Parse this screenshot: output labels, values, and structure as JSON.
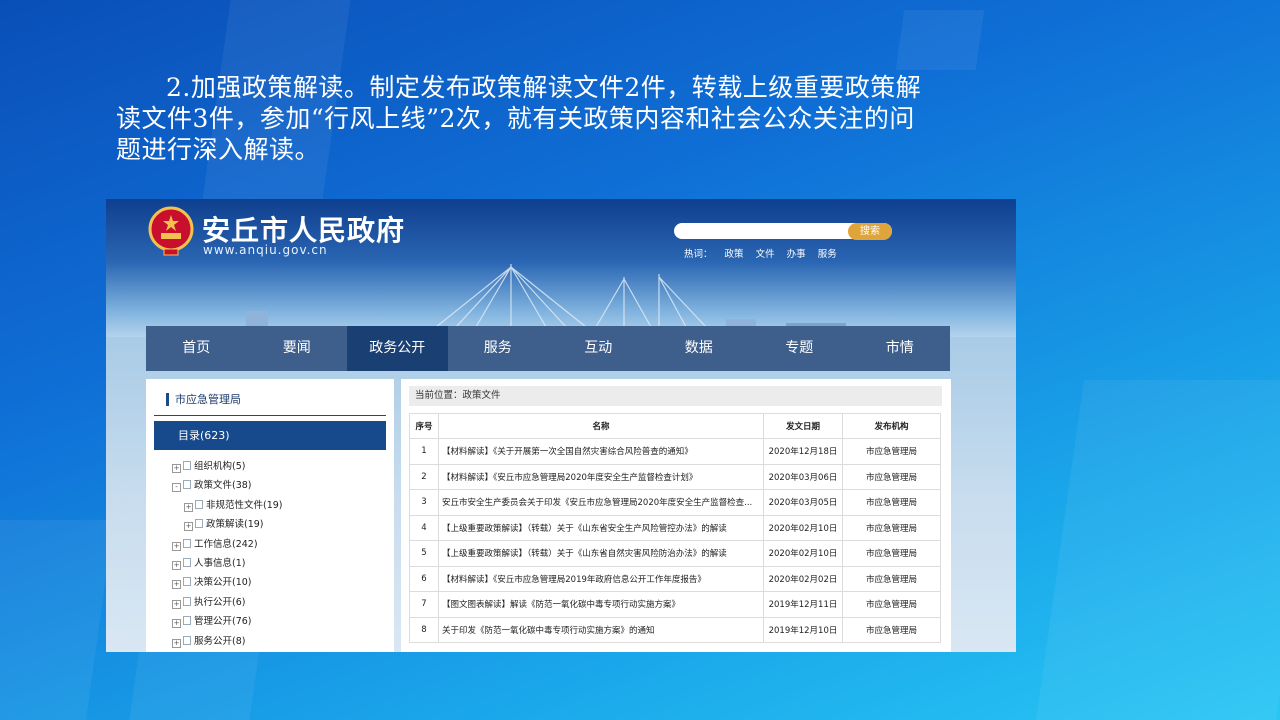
{
  "slide": {
    "paragraph": "2.加强政策解读。制定发布政策解读文件2件，转载上级重要政策解读文件3件，参加“行风上线”2次，就有关政策内容和社会公众关注的问题进行深入解读。"
  },
  "site": {
    "title": "安丘市人民政府",
    "url": "www.anqiu.gov.cn",
    "search_button": "搜索",
    "hot_label": "热词：",
    "hot_words": [
      "政策",
      "文件",
      "办事",
      "服务"
    ]
  },
  "nav": [
    "首页",
    "要闻",
    "政务公开",
    "服务",
    "互动",
    "数据",
    "专题",
    "市情"
  ],
  "sidebar": {
    "department": "市应急管理局",
    "directory": "目录(623)",
    "tree": [
      {
        "label": "组织机构(5)",
        "level": 0,
        "sign": "+"
      },
      {
        "label": "政策文件(38)",
        "level": 0,
        "sign": "-"
      },
      {
        "label": "非规范性文件(19)",
        "level": 1,
        "sign": "+"
      },
      {
        "label": "政策解读(19)",
        "level": 1,
        "sign": "+"
      },
      {
        "label": "工作信息(242)",
        "level": 0,
        "sign": "+"
      },
      {
        "label": "人事信息(1)",
        "level": 0,
        "sign": "+"
      },
      {
        "label": "决策公开(10)",
        "level": 0,
        "sign": "+"
      },
      {
        "label": "执行公开(6)",
        "level": 0,
        "sign": "+"
      },
      {
        "label": "管理公开(76)",
        "level": 0,
        "sign": "+"
      },
      {
        "label": "服务公开(8)",
        "level": 0,
        "sign": "+"
      }
    ]
  },
  "breadcrumb": "当前位置：政策文件",
  "table": {
    "headers": [
      "序号",
      "名称",
      "发文日期",
      "发布机构"
    ],
    "rows": [
      [
        "1",
        "【材料解读】《关于开展第一次全国自然灾害综合风险普查的通知》",
        "2020年12月18日",
        "市应急管理局"
      ],
      [
        "2",
        "【材料解读】《安丘市应急管理局2020年度安全生产监督检查计划》",
        "2020年03月06日",
        "市应急管理局"
      ],
      [
        "3",
        "安丘市安全生产委员会关于印发《安丘市应急管理局2020年度安全生产监督检查...",
        "2020年03月05日",
        "市应急管理局"
      ],
      [
        "4",
        "【上级重要政策解读】（转载）关于《山东省安全生产风险管控办法》的解读",
        "2020年02月10日",
        "市应急管理局"
      ],
      [
        "5",
        "【上级重要政策解读】（转载）关于《山东省自然灾害风险防治办法》的解读",
        "2020年02月10日",
        "市应急管理局"
      ],
      [
        "6",
        "【材料解读】《安丘市应急管理局2019年政府信息公开工作年度报告》",
        "2020年02月02日",
        "市应急管理局"
      ],
      [
        "7",
        "【图文图表解读】解读《防范一氧化碳中毒专项行动实施方案》",
        "2019年12月11日",
        "市应急管理局"
      ],
      [
        "8",
        "关于印发《防范一氧化碳中毒专项行动实施方案》的通知",
        "2019年12月10日",
        "市应急管理局"
      ]
    ]
  },
  "colors": {
    "slide_bg": "#0f6fd6",
    "nav_bg": "#3e5f8c",
    "nav_active": "#1a3f73",
    "directory_bg": "#164a8c",
    "search_button": "#e0a53a"
  }
}
